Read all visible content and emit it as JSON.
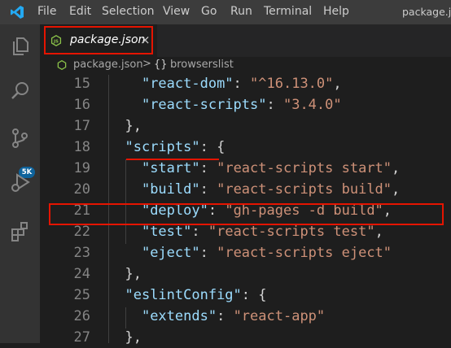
{
  "menu": [
    "File",
    "Edit",
    "Selection",
    "View",
    "Go",
    "Run",
    "Terminal",
    "Help"
  ],
  "window_title": "package.json",
  "activity_bar": {
    "icons": [
      "files-icon",
      "search-icon",
      "source-control-icon",
      "run-debug-icon",
      "extensions-icon"
    ],
    "badge": "5K"
  },
  "tab": {
    "label": "package.json",
    "close": "×",
    "icon": "js-icon"
  },
  "breadcrumb": {
    "file": "package.json",
    "separator": ">",
    "symbol_icon": "{}",
    "symbol": "browserslist"
  },
  "code_lines": [
    {
      "n": "15",
      "indent": "    ",
      "tokens": [
        {
          "t": "\"react-dom\"",
          "c": "k"
        },
        {
          "t": ": ",
          "c": "p"
        },
        {
          "t": "\"^16.13.0\"",
          "c": "s"
        },
        {
          "t": ",",
          "c": "p"
        }
      ]
    },
    {
      "n": "16",
      "indent": "    ",
      "tokens": [
        {
          "t": "\"react-scripts\"",
          "c": "k"
        },
        {
          "t": ": ",
          "c": "p"
        },
        {
          "t": "\"3.4.0\"",
          "c": "s"
        }
      ]
    },
    {
      "n": "17",
      "indent": "  ",
      "tokens": [
        {
          "t": "},",
          "c": "p"
        }
      ]
    },
    {
      "n": "18",
      "indent": "  ",
      "tokens": [
        {
          "t": "\"scripts\"",
          "c": "k"
        },
        {
          "t": ": {",
          "c": "p"
        }
      ]
    },
    {
      "n": "19",
      "indent": "    ",
      "tokens": [
        {
          "t": "\"start\"",
          "c": "k"
        },
        {
          "t": ": ",
          "c": "p"
        },
        {
          "t": "\"react-scripts start\"",
          "c": "s"
        },
        {
          "t": ",",
          "c": "p"
        }
      ]
    },
    {
      "n": "20",
      "indent": "    ",
      "tokens": [
        {
          "t": "\"build\"",
          "c": "k"
        },
        {
          "t": ": ",
          "c": "p"
        },
        {
          "t": "\"react-scripts build\"",
          "c": "s"
        },
        {
          "t": ",",
          "c": "p"
        }
      ]
    },
    {
      "n": "21",
      "indent": "    ",
      "tokens": [
        {
          "t": "\"deploy\"",
          "c": "k"
        },
        {
          "t": ": ",
          "c": "p"
        },
        {
          "t": "\"gh-pages -d build\"",
          "c": "s"
        },
        {
          "t": ",",
          "c": "p"
        }
      ]
    },
    {
      "n": "22",
      "indent": "    ",
      "tokens": [
        {
          "t": "\"test\"",
          "c": "k"
        },
        {
          "t": ": ",
          "c": "p"
        },
        {
          "t": "\"react-scripts test\"",
          "c": "s"
        },
        {
          "t": ",",
          "c": "p"
        }
      ]
    },
    {
      "n": "23",
      "indent": "    ",
      "tokens": [
        {
          "t": "\"eject\"",
          "c": "k"
        },
        {
          "t": ": ",
          "c": "p"
        },
        {
          "t": "\"react-scripts eject\"",
          "c": "s"
        }
      ]
    },
    {
      "n": "24",
      "indent": "  ",
      "tokens": [
        {
          "t": "},",
          "c": "p"
        }
      ]
    },
    {
      "n": "25",
      "indent": "  ",
      "tokens": [
        {
          "t": "\"eslintConfig\"",
          "c": "k"
        },
        {
          "t": ": {",
          "c": "p"
        }
      ]
    },
    {
      "n": "26",
      "indent": "    ",
      "tokens": [
        {
          "t": "\"extends\"",
          "c": "k"
        },
        {
          "t": ": ",
          "c": "p"
        },
        {
          "t": "\"react-app\"",
          "c": "s"
        }
      ]
    },
    {
      "n": "27",
      "indent": "  ",
      "tokens": [
        {
          "t": "},",
          "c": "p"
        }
      ]
    }
  ],
  "colors": {
    "highlight_box": "#e51400",
    "json_key": "#9cdcfe",
    "json_string": "#ce9178",
    "punctuation": "#d4d4d4",
    "line_number": "#858585",
    "js_icon": "#8bc34a"
  }
}
